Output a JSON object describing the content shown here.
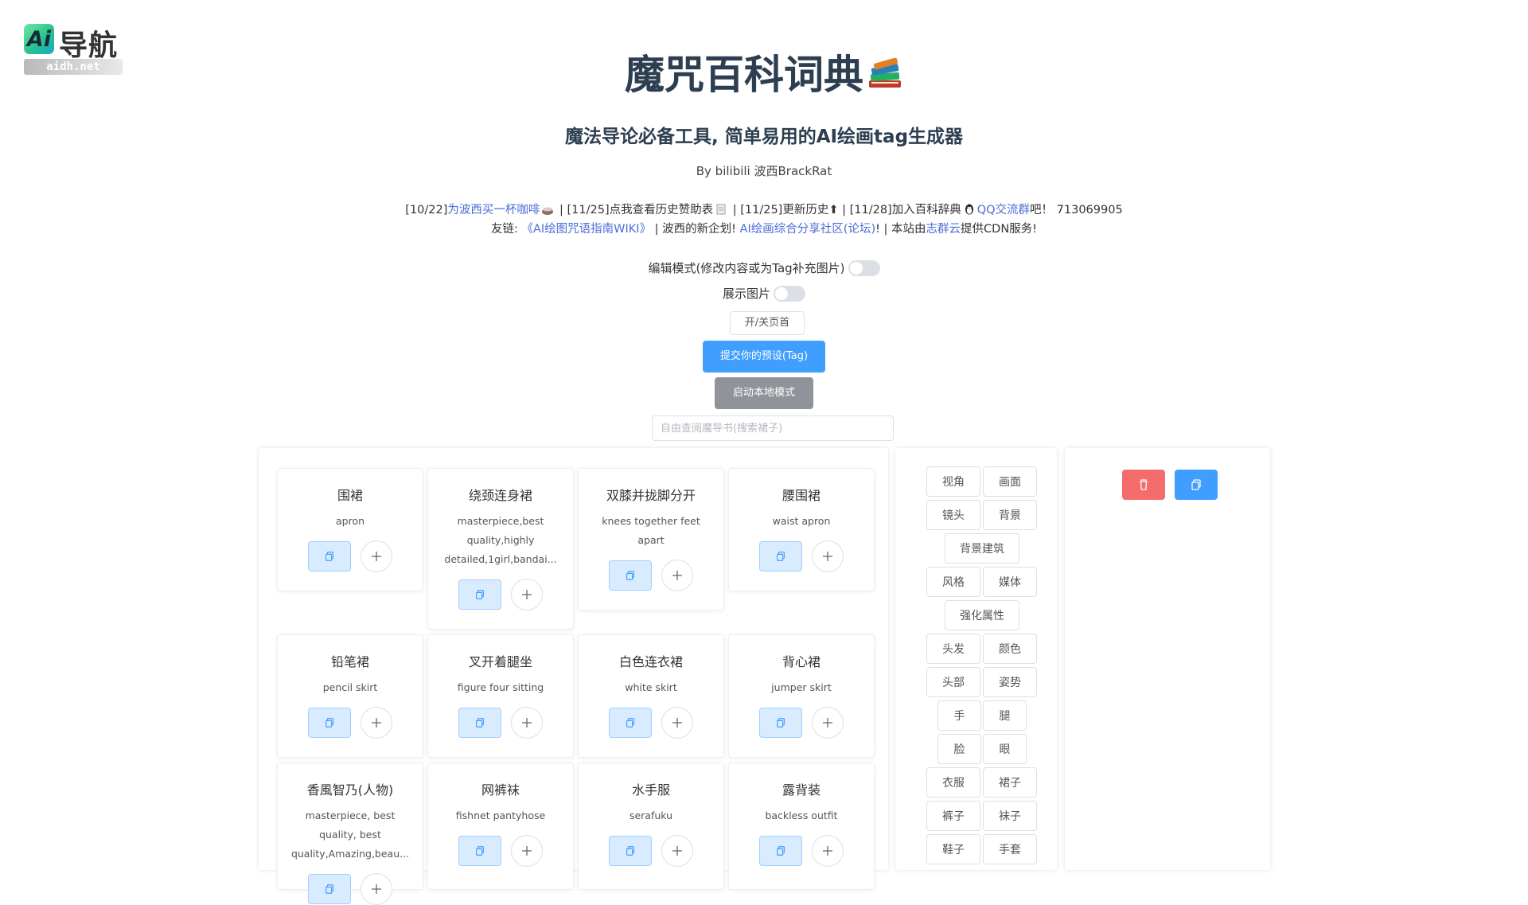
{
  "logo": {
    "mark": "Ai",
    "text": "导航",
    "domain": "aidh.net"
  },
  "header": {
    "title": "魔咒百科词典",
    "subtitle": "魔法导论必备工具, 简单易用的AI绘画tag生成器",
    "byline": "By bilibili 波西BrackRat"
  },
  "news": {
    "line1": {
      "p1": "[10/22]",
      "link1": "为波西买一杯咖啡",
      "p2": " | [11/25]点我查看历史赞助表",
      "p3": " | [11/25]更新历史",
      "arrow": "⬆",
      "p4": " | [11/28]加入百科辞典",
      "link2": "QQ交流群",
      "p5": "吧！ 713069905"
    },
    "line2": {
      "p1": "友链: ",
      "link1": "《AI绘图咒语指南WIKI》",
      "p2": " | 波西的新企划! ",
      "link2": "AI绘画综合分享社区(论坛)",
      "p3": "! | 本站由",
      "link3": "志群云",
      "p4": "提供CDN服务!"
    }
  },
  "controls": {
    "edit_mode_label": "编辑模式(修改内容或为Tag补充图片)",
    "show_images_label": "展示图片",
    "toggle_header_label": "开/关页首",
    "submit_label": "提交你的预设(Tag)",
    "local_mode_label": "启动本地模式",
    "search_placeholder": "自由查阅魔导书(搜索裙子)"
  },
  "cards": [
    {
      "name": "围裙",
      "tags": "apron"
    },
    {
      "name": "绕颈连身裙",
      "tags": "masterpiece,best quality,highly detailed,1girl,bandai..."
    },
    {
      "name": "双膝并拢脚分开",
      "tags": "knees together feet apart"
    },
    {
      "name": "腰围裙",
      "tags": "waist apron"
    },
    {
      "name": "铅笔裙",
      "tags": "pencil skirt"
    },
    {
      "name": "叉开着腿坐",
      "tags": "figure four sitting"
    },
    {
      "name": "白色连衣裙",
      "tags": "white skirt"
    },
    {
      "name": "背心裙",
      "tags": "jumper skirt"
    },
    {
      "name": "香風智乃(人物)",
      "tags": "masterpiece, best quality, best quality,Amazing,beau..."
    },
    {
      "name": "网裤袜",
      "tags": "fishnet pantyhose"
    },
    {
      "name": "水手服",
      "tags": "serafuku"
    },
    {
      "name": "露背装",
      "tags": "backless outfit"
    }
  ],
  "categories": [
    "视角",
    "画面",
    "镜头",
    "背景",
    "背景建筑",
    "风格",
    "媒体",
    "强化属性",
    "头发",
    "颜色",
    "头部",
    "姿势",
    "手",
    "腿",
    "脸",
    "眼",
    "衣服",
    "裙子",
    "裤子",
    "袜子",
    "鞋子",
    "手套"
  ],
  "colors": {
    "primary": "#409eff",
    "danger": "#f56c6c",
    "info": "#909399",
    "link": "#4a6cd8"
  },
  "icons": {
    "copy": "copy-icon",
    "add": "plus-icon",
    "delete": "trash-icon"
  }
}
